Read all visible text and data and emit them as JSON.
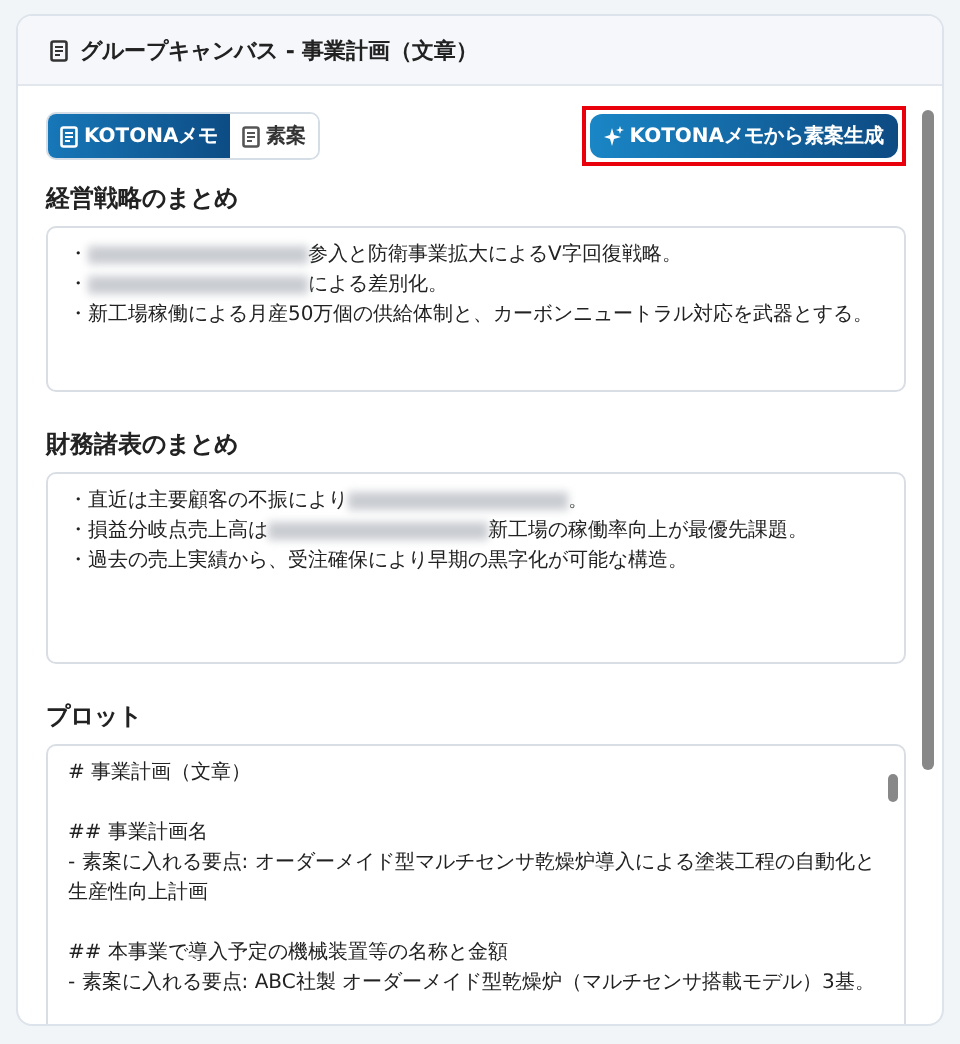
{
  "window": {
    "title": "グループキャンバス - 事業計画（文章）"
  },
  "tabs": [
    {
      "label": "KOTONAメモ",
      "selected": true
    },
    {
      "label": "素案",
      "selected": false
    }
  ],
  "generate_button": {
    "label": "KOTONAメモから素案生成",
    "highlighted": true
  },
  "sections": [
    {
      "title": "経営戦略のまとめ",
      "lines": [
        {
          "parts": [
            {
              "kind": "text",
              "text": "・"
            },
            {
              "kind": "redacted"
            },
            {
              "kind": "text",
              "text": "参入と防衛事業拡大によるV字回復戦略。"
            }
          ]
        },
        {
          "parts": [
            {
              "kind": "text",
              "text": "・"
            },
            {
              "kind": "redacted"
            },
            {
              "kind": "text",
              "text": "による差別化。"
            }
          ]
        },
        {
          "parts": [
            {
              "kind": "text",
              "text": "・新工場稼働による月産50万個の供給体制と、カーボンニュートラル対応を武器とする。"
            }
          ]
        }
      ]
    },
    {
      "title": "財務諸表のまとめ",
      "lines": [
        {
          "parts": [
            {
              "kind": "text",
              "text": "・直近は主要顧客の不振により"
            },
            {
              "kind": "redacted"
            },
            {
              "kind": "text",
              "text": "。"
            }
          ]
        },
        {
          "parts": [
            {
              "kind": "text",
              "text": "・損益分岐点売上高は"
            },
            {
              "kind": "redacted"
            },
            {
              "kind": "text",
              "text": "新工場の稼働率向上が最優先課題。"
            }
          ]
        },
        {
          "parts": [
            {
              "kind": "text",
              "text": "・過去の売上実績から、受注確保により早期の黒字化が可能な構造。"
            }
          ]
        }
      ]
    },
    {
      "title": "プロット",
      "lines": [
        {
          "parts": [
            {
              "kind": "text",
              "text": "# 事業計画（文章）"
            }
          ]
        },
        {
          "kind": "blank"
        },
        {
          "parts": [
            {
              "kind": "text",
              "text": "## 事業計画名"
            }
          ]
        },
        {
          "parts": [
            {
              "kind": "text",
              "text": "- 素案に入れる要点: オーダーメイド型マルチセンサ乾燥炉導入による塗装工程の自動化と生産性向上計画"
            }
          ]
        },
        {
          "kind": "blank"
        },
        {
          "parts": [
            {
              "kind": "text",
              "text": "## 本事業で導入予定の機械装置等の名称と金額"
            }
          ]
        },
        {
          "parts": [
            {
              "kind": "text",
              "text": "- 素案に入れる要点: ABC社製 オーダーメイド型乾燥炉（マルチセンサ搭載モデル）3基。"
            }
          ]
        }
      ]
    }
  ]
}
